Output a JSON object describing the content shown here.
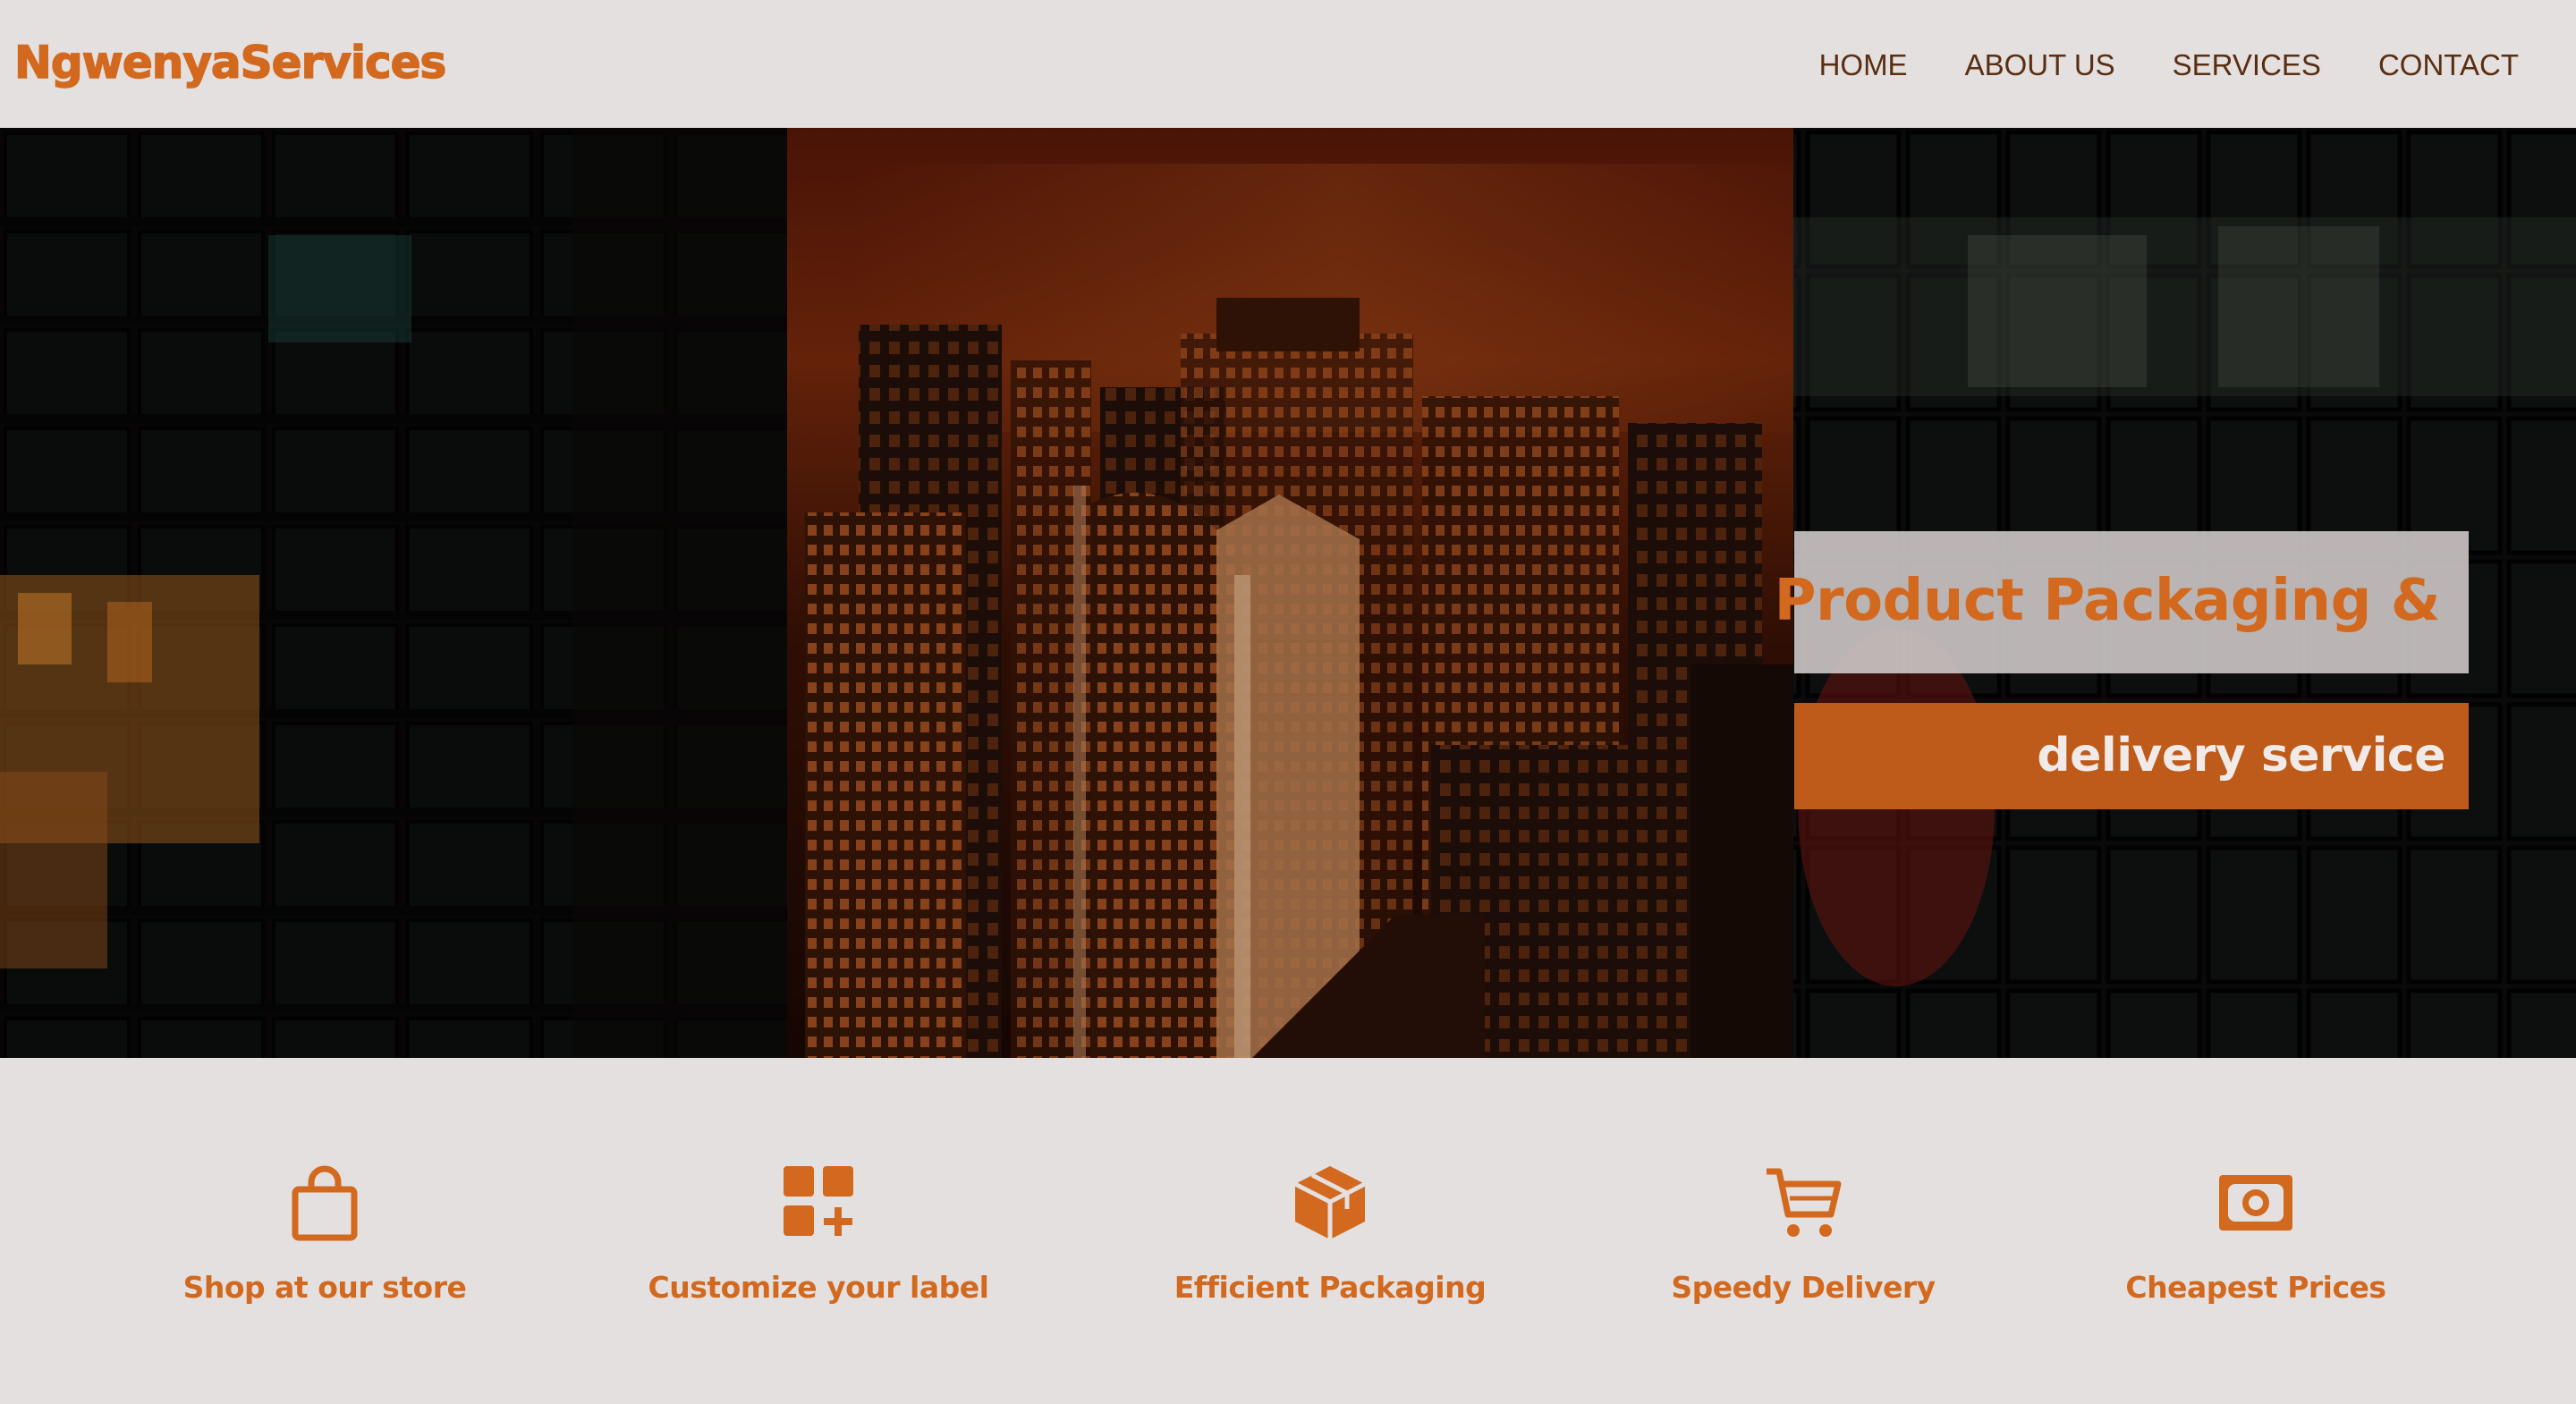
{
  "brand": {
    "name": "NgwenyaServices",
    "accent": "#d2691e"
  },
  "nav": {
    "items": [
      {
        "label": "HOME"
      },
      {
        "label": "ABOUT US"
      },
      {
        "label": "SERVICES"
      },
      {
        "label": "CONTACT"
      }
    ]
  },
  "hero": {
    "headline_line1": "Product Packaging &",
    "headline_line2": "delivery service",
    "background": "night city skyline with skyscrapers in orange tones"
  },
  "features": [
    {
      "label": "Shop at our store",
      "icon": "shopping-bag-icon"
    },
    {
      "label": "Customize your label",
      "icon": "grid-plus-icon"
    },
    {
      "label": "Efficient Packaging",
      "icon": "package-box-icon"
    },
    {
      "label": "Speedy Delivery",
      "icon": "shopping-cart-icon"
    },
    {
      "label": "Cheapest Prices",
      "icon": "money-bill-icon"
    }
  ]
}
